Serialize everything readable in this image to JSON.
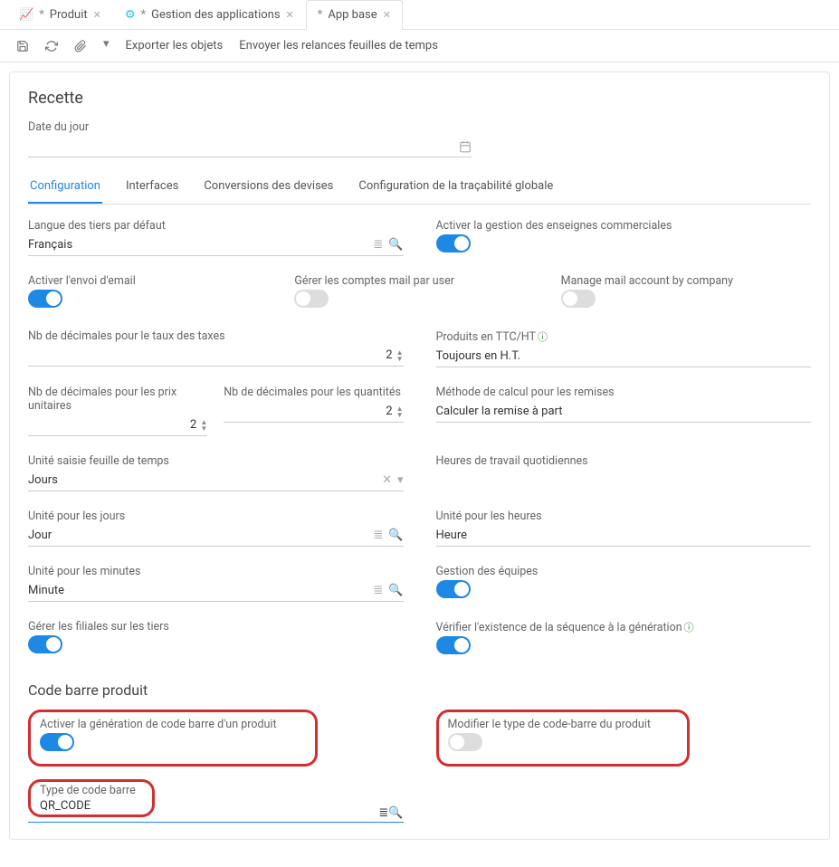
{
  "tabs": [
    {
      "label": "Produit",
      "dirty": true,
      "icon": "chart"
    },
    {
      "label": "Gestion des applications",
      "dirty": true,
      "icon": "gear"
    },
    {
      "label": "App base",
      "dirty": true,
      "icon": "",
      "active": true
    }
  ],
  "toolbar": {
    "export": "Exporter les objets",
    "relance": "Envoyer les relances feuilles de temps"
  },
  "header": {
    "title": "Recette",
    "date_label": "Date du jour",
    "date_value": ""
  },
  "innertabs": [
    "Configuration",
    "Interfaces",
    "Conversions des devises",
    "Configuration de la traçabilité globale"
  ],
  "config": {
    "lang_label": "Langue des tiers par défaut",
    "lang_value": "Français",
    "enseignes_label": "Activer la gestion des enseignes commerciales",
    "enseignes_on": true,
    "email_label": "Activer l'envoi d'email",
    "email_on": true,
    "mail_user_label": "Gérer les comptes mail par user",
    "mail_user_on": false,
    "mail_company_label": "Manage mail account by company",
    "mail_company_on": false,
    "tax_dec_label": "Nb de décimales pour le taux des taxes",
    "tax_dec_value": "2",
    "ttc_label": "Produits en TTC/HT",
    "ttc_value": "Toujours en H.T.",
    "price_dec_label": "Nb de décimales pour les prix unitaires",
    "price_dec_value": "2",
    "qty_dec_label": "Nb de décimales pour les quantités",
    "qty_dec_value": "2",
    "remise_label": "Méthode de calcul pour les remises",
    "remise_value": "Calculer la remise à part",
    "unit_ts_label": "Unité saisie feuille de temps",
    "unit_ts_value": "Jours",
    "heures_quot_label": "Heures de travail quotidiennes",
    "unit_jours_label": "Unité pour les jours",
    "unit_jours_value": "Jour",
    "unit_heures_label": "Unité pour les heures",
    "unit_heures_value": "Heure",
    "unit_min_label": "Unité pour les minutes",
    "unit_min_value": "Minute",
    "equipes_label": "Gestion des équipes",
    "equipes_on": true,
    "filiales_label": "Gérer les filiales sur les tiers",
    "filiales_on": true,
    "seq_label": "Vérifier l'existence de la séquence à la génération",
    "seq_on": true
  },
  "barcode": {
    "title": "Code barre produit",
    "gen_label": "Activer la génération de code barre d'un produit",
    "gen_on": true,
    "edit_type_label": "Modifier le type de code-barre du produit",
    "edit_type_on": false,
    "type_label": "Type de code barre",
    "type_value": "QR_CODE"
  }
}
